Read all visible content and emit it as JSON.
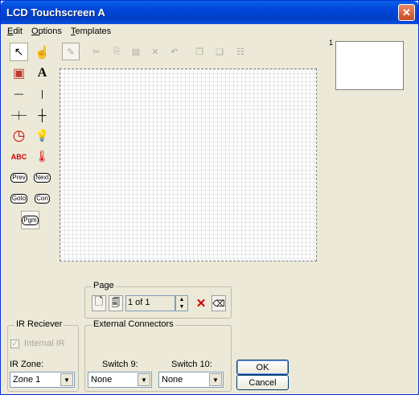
{
  "window": {
    "title": "LCD Touchscreen A",
    "close_glyph": "✕"
  },
  "menu": {
    "items": [
      {
        "label_rest": "dit",
        "hotkey": "E"
      },
      {
        "label_rest": "ptions",
        "hotkey": "O"
      },
      {
        "label_rest": "emplates",
        "hotkey": "T"
      }
    ]
  },
  "tools": [
    {
      "name": "pointer-tool-icon",
      "glyph": "↖"
    },
    {
      "name": "hand-tool-icon",
      "glyph": "☝"
    },
    {
      "name": "image-tool-icon",
      "glyph": "▣"
    },
    {
      "name": "text-tool-icon",
      "glyph": "A"
    },
    {
      "name": "horizontal-line-tool-icon",
      "glyph": "—"
    },
    {
      "name": "vertical-line-tool-icon",
      "glyph": "|"
    },
    {
      "name": "horizontal-slider-tool-icon",
      "glyph": "─┼─"
    },
    {
      "name": "vertical-slider-tool-icon",
      "glyph": "┼"
    },
    {
      "name": "clock-tool-icon",
      "glyph": "◷"
    },
    {
      "name": "lightbulb-tool-icon",
      "glyph": "💡"
    },
    {
      "name": "abc-text-tool-icon",
      "glyph": "ABC"
    },
    {
      "name": "thermometer-tool-icon",
      "glyph": "🌡"
    }
  ],
  "chip_tools": {
    "prev": "Prev",
    "next": "Next",
    "goto": "Goto",
    "con": "Con",
    "pgm": "Pgm"
  },
  "preview": {
    "page_number": "1"
  },
  "page_group": {
    "label": "Page",
    "counter": "1 of 1",
    "delete_glyph": "✕"
  },
  "ir_group": {
    "label": "IR Reciever",
    "internal_ir": "Internal IR",
    "zone_label": "IR Zone:",
    "zone_value": "Zone 1"
  },
  "connectors_group": {
    "label": "External Connectors",
    "switch9_label": "Switch 9:",
    "switch9_value": "None",
    "switch10_label": "Switch 10:",
    "switch10_value": "None"
  },
  "buttons": {
    "ok": "OK",
    "cancel": "Cancel"
  },
  "colors": {
    "titlebar": "#0146d8",
    "window_bg": "#ece9d8",
    "delete_red": "#cc0000"
  }
}
